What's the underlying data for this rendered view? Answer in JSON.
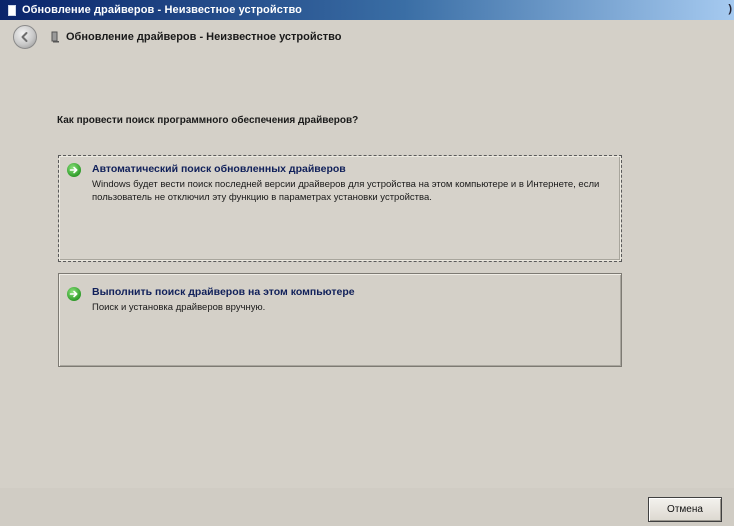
{
  "window": {
    "title": "Обновление драйверов - Неизвестное устройство"
  },
  "nav": {
    "back_icon": "back-arrow-icon",
    "device_icon": "device-icon",
    "title": "Обновление драйверов - Неизвестное устройство"
  },
  "main": {
    "question": "Как провести поиск программного обеспечения драйверов?",
    "options": [
      {
        "icon": "green-arrow-icon",
        "title": "Автоматический поиск обновленных драйверов",
        "description": "Windows будет вести поиск последней версии драйверов для устройства на этом компьютере и в Интернете, если пользователь не отключил эту функцию в параметрах установки устройства."
      },
      {
        "icon": "green-arrow-icon",
        "title": "Выполнить поиск драйверов на этом компьютере",
        "description": "Поиск и установка драйверов вручную."
      }
    ]
  },
  "footer": {
    "cancel_label": "Отмена"
  },
  "colors": {
    "title_bar_start": "#0a246a",
    "title_bar_end": "#a6caf0",
    "window_background": "#d4d0c8",
    "link_text": "#10205a",
    "arrow_green": "#2f9c2a"
  }
}
